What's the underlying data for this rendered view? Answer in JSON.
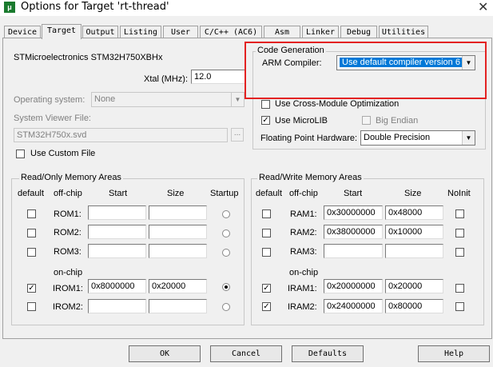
{
  "window": {
    "title": "Options for Target 'rt-thread'",
    "close_glyph": "✕"
  },
  "tabs": [
    "Device",
    "Target",
    "Output",
    "Listing",
    "User",
    "C/C++ (AC6)",
    "Asm",
    "Linker",
    "Debug",
    "Utilities"
  ],
  "active_tab": "Target",
  "device_name": "STMicroelectronics STM32H750XBHx",
  "xtal": {
    "label": "Xtal (MHz):",
    "value": "12.0"
  },
  "os": {
    "label": "Operating system:",
    "value": "None"
  },
  "svd": {
    "label": "System Viewer File:",
    "value": "STM32H750x.svd",
    "browse": "..."
  },
  "custom_file": {
    "label": "Use Custom File",
    "checked": false
  },
  "code_gen": {
    "title": "Code Generation",
    "compiler_label": "ARM Compiler:",
    "compiler_value": "Use default compiler version 6",
    "cross_module": {
      "label": "Use Cross-Module Optimization",
      "checked": false
    },
    "microlib": {
      "label": "Use MicroLIB",
      "checked": true
    },
    "big_endian": {
      "label": "Big Endian",
      "checked": false
    },
    "fph_label": "Floating Point Hardware:",
    "fph_value": "Double Precision"
  },
  "rom_group": {
    "title": "Read/Only Memory Areas",
    "headers": {
      "default": "default",
      "offchip": "off-chip",
      "start": "Start",
      "size": "Size",
      "startup": "Startup"
    },
    "onchip_label": "on-chip",
    "rows": [
      {
        "name": "ROM1:",
        "start": "",
        "size": "",
        "default": false,
        "startup": false
      },
      {
        "name": "ROM2:",
        "start": "",
        "size": "",
        "default": false,
        "startup": false
      },
      {
        "name": "ROM3:",
        "start": "",
        "size": "",
        "default": false,
        "startup": false
      },
      {
        "name": "IROM1:",
        "start": "0x8000000",
        "size": "0x20000",
        "default": true,
        "startup": true
      },
      {
        "name": "IROM2:",
        "start": "",
        "size": "",
        "default": false,
        "startup": false
      }
    ]
  },
  "ram_group": {
    "title": "Read/Write Memory Areas",
    "headers": {
      "default": "default",
      "offchip": "off-chip",
      "start": "Start",
      "size": "Size",
      "noinit": "NoInit"
    },
    "onchip_label": "on-chip",
    "rows": [
      {
        "name": "RAM1:",
        "start": "0x30000000",
        "size": "0x48000",
        "default": false,
        "noinit": false
      },
      {
        "name": "RAM2:",
        "start": "0x38000000",
        "size": "0x10000",
        "default": false,
        "noinit": false
      },
      {
        "name": "RAM3:",
        "start": "",
        "size": "",
        "default": false,
        "noinit": false
      },
      {
        "name": "IRAM1:",
        "start": "0x20000000",
        "size": "0x20000",
        "default": true,
        "noinit": false
      },
      {
        "name": "IRAM2:",
        "start": "0x24000000",
        "size": "0x80000",
        "default": true,
        "noinit": false
      }
    ]
  },
  "buttons": {
    "ok": "OK",
    "cancel": "Cancel",
    "defaults": "Defaults",
    "help": "Help"
  },
  "colors": {
    "highlight": "#0078d7",
    "annotation_box": "#e32222"
  }
}
